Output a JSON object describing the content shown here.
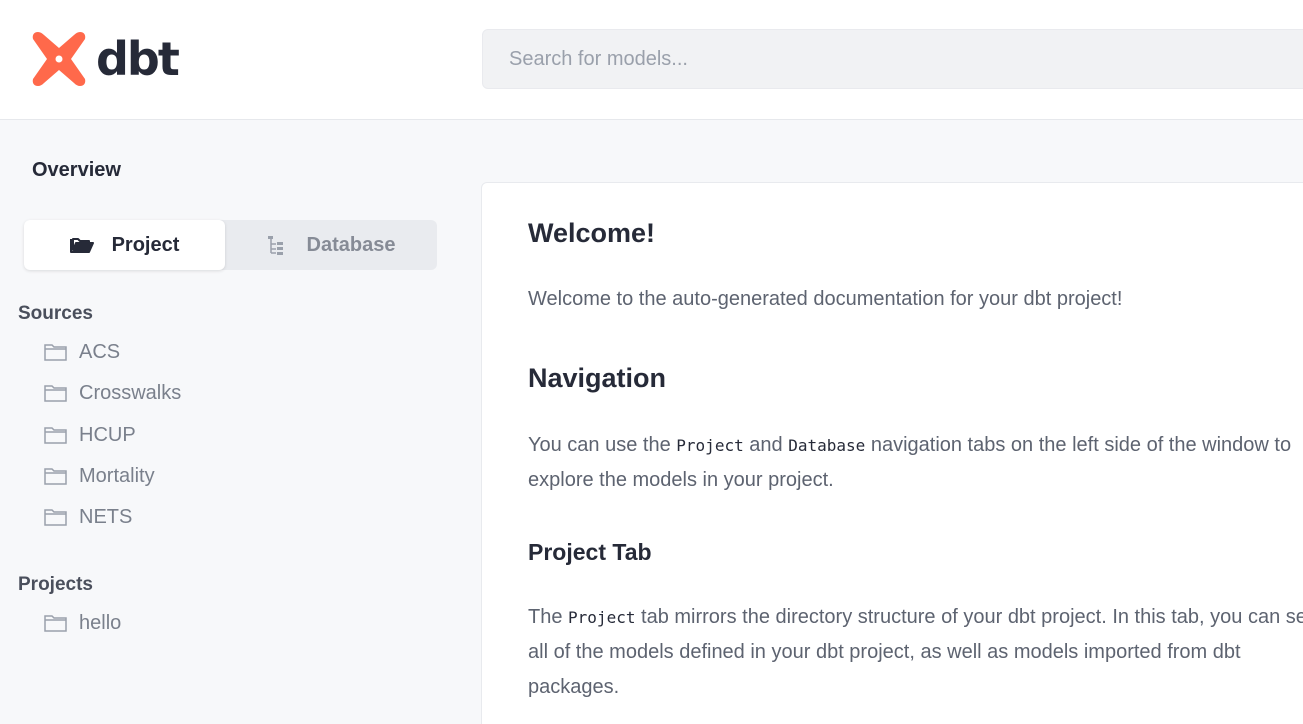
{
  "header": {
    "logo_text": "dbt",
    "search_placeholder": "Search for models..."
  },
  "sidebar": {
    "overview_label": "Overview",
    "tabs": [
      {
        "label": "Project",
        "icon": "folder-open-icon",
        "active": true
      },
      {
        "label": "Database",
        "icon": "tree-icon",
        "active": false
      }
    ],
    "sources": {
      "title": "Sources",
      "items": [
        "ACS",
        "Crosswalks",
        "HCUP",
        "Mortality",
        "NETS"
      ]
    },
    "projects": {
      "title": "Projects",
      "items": [
        "hello"
      ]
    }
  },
  "main": {
    "welcome_heading": "Welcome!",
    "welcome_text": "Welcome to the auto-generated documentation for your dbt project!",
    "navigation_heading": "Navigation",
    "navigation_text": {
      "part1": "You can use the ",
      "code1": "Project",
      "part2": " and ",
      "code2": "Database",
      "part3": " navigation tabs on the left side of the window to explore the models in your project."
    },
    "project_tab_heading": "Project Tab",
    "project_tab_text": {
      "part1": "The ",
      "code1": "Project",
      "part2": " tab mirrors the directory structure of your dbt project. In this tab, you can see all of the models defined in your dbt project, as well as models imported from dbt packages."
    }
  },
  "colors": {
    "brand": "#ff694b",
    "text_dark": "#262a38",
    "text_muted": "#7a808c"
  }
}
